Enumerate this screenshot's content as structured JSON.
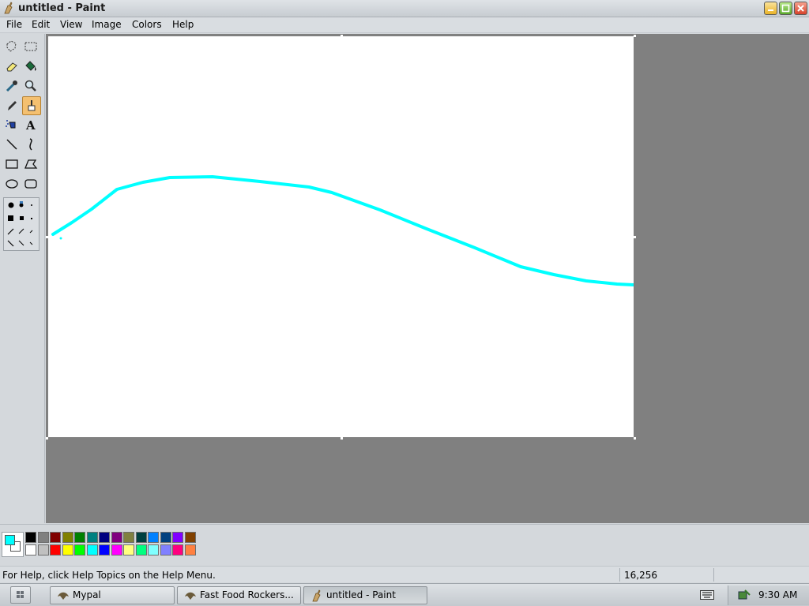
{
  "window": {
    "title": "untitled - Paint"
  },
  "menu": [
    "File",
    "Edit",
    "View",
    "Image",
    "Colors",
    "Help"
  ],
  "tools": [
    {
      "name": "free-form-select",
      "icon": "free-select-icon"
    },
    {
      "name": "select",
      "icon": "rect-select-icon"
    },
    {
      "name": "eraser",
      "icon": "eraser-icon"
    },
    {
      "name": "fill",
      "icon": "fill-bucket-icon"
    },
    {
      "name": "pick-color",
      "icon": "eyedropper-icon"
    },
    {
      "name": "magnifier",
      "icon": "magnifier-icon"
    },
    {
      "name": "pencil",
      "icon": "pencil-icon"
    },
    {
      "name": "brush",
      "icon": "brush-icon",
      "active": true
    },
    {
      "name": "airbrush",
      "icon": "airbrush-icon"
    },
    {
      "name": "text",
      "icon": "text-icon"
    },
    {
      "name": "line",
      "icon": "line-icon"
    },
    {
      "name": "curve",
      "icon": "curve-icon"
    },
    {
      "name": "rectangle",
      "icon": "rectangle-icon"
    },
    {
      "name": "polygon",
      "icon": "polygon-icon"
    },
    {
      "name": "ellipse",
      "icon": "ellipse-icon"
    },
    {
      "name": "rounded-rectangle",
      "icon": "rounded-rect-icon"
    }
  ],
  "drawing": {
    "stroke_color": "#00ffff"
  },
  "colors": {
    "foreground": "#00ffff",
    "background": "#ffffff",
    "palette_top": [
      "#000000",
      "#808080",
      "#800000",
      "#808000",
      "#008000",
      "#008080",
      "#000080",
      "#800080",
      "#808040",
      "#004040",
      "#0080ff",
      "#004080",
      "#8000ff",
      "#804000"
    ],
    "palette_bottom": [
      "#ffffff",
      "#c0c0c0",
      "#ff0000",
      "#ffff00",
      "#00ff00",
      "#00ffff",
      "#0000ff",
      "#ff00ff",
      "#ffff80",
      "#00ff80",
      "#80ffff",
      "#8080ff",
      "#ff0080",
      "#ff8040"
    ]
  },
  "status": {
    "help_text": "For Help, click Help Topics on the Help Menu.",
    "coords": "16,256"
  },
  "taskbar": {
    "items": [
      {
        "label": "Mypal",
        "active": false
      },
      {
        "label": "Fast Food Rockers...",
        "active": false
      },
      {
        "label": "untitled - Paint",
        "active": true
      }
    ],
    "clock": "9:30 AM"
  }
}
